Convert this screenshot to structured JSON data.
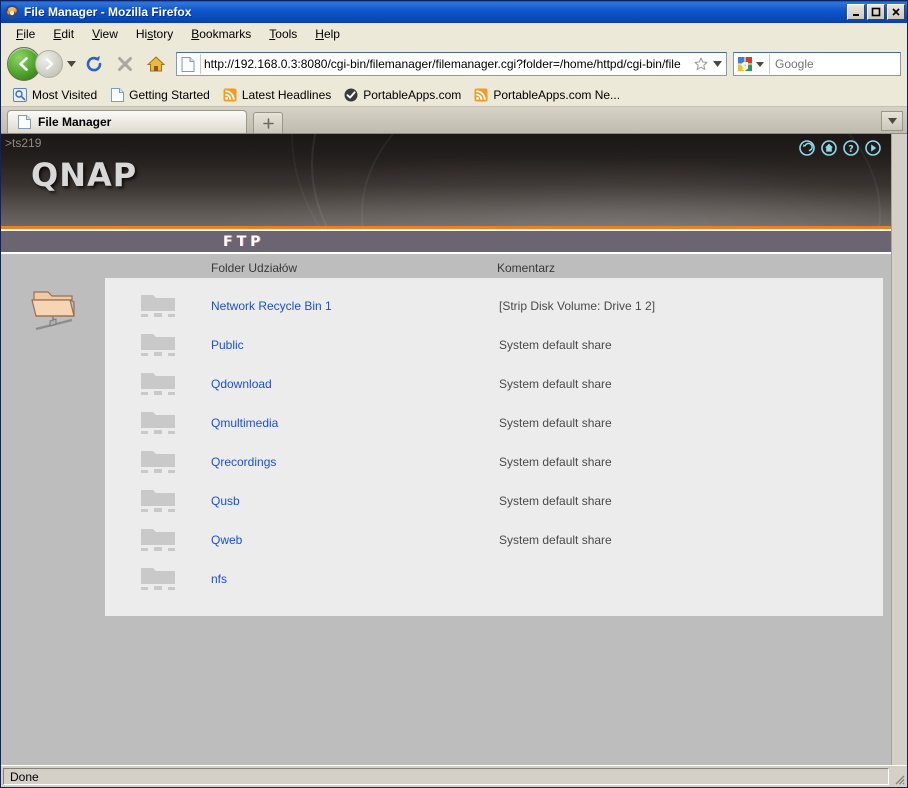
{
  "window": {
    "title": "File Manager - Mozilla Firefox",
    "minimize_label": "Minimize",
    "maximize_label": "Maximize",
    "close_label": "Close"
  },
  "menubar": {
    "items": [
      {
        "label": "File",
        "accel": "F"
      },
      {
        "label": "Edit",
        "accel": "E"
      },
      {
        "label": "View",
        "accel": "V"
      },
      {
        "label": "History",
        "accel": "s"
      },
      {
        "label": "Bookmarks",
        "accel": "B"
      },
      {
        "label": "Tools",
        "accel": "T"
      },
      {
        "label": "Help",
        "accel": "H"
      }
    ]
  },
  "toolbar": {
    "back_icon": "back-arrow-icon",
    "forward_icon": "forward-arrow-icon",
    "history_dropdown_icon": "chevron-down-icon",
    "reload_icon": "reload-icon",
    "stop_icon": "stop-icon",
    "home_icon": "home-icon",
    "url": "http://192.168.0.3:8080/cgi-bin/filemanager/filemanager.cgi?folder=/home/httpd/cgi-bin/file",
    "url_page_icon": "page-icon",
    "bookmark_star_icon": "star-icon",
    "url_dropdown_icon": "chevron-down-icon"
  },
  "search": {
    "engine": "Google",
    "engine_icon": "google-logo-icon",
    "engine_dropdown_icon": "chevron-down-icon",
    "placeholder": "Google",
    "go_icon": "magnifier-icon"
  },
  "bookmarks": {
    "items": [
      {
        "label": "Most Visited",
        "icon": "most-visited-icon"
      },
      {
        "label": "Getting Started",
        "icon": "page-icon"
      },
      {
        "label": "Latest Headlines",
        "icon": "rss-feed-icon"
      },
      {
        "label": "PortableApps.com",
        "icon": "portableapps-icon"
      },
      {
        "label": "PortableApps.com Ne...",
        "icon": "rss-feed-icon"
      }
    ]
  },
  "tabs": {
    "active": {
      "label": "File Manager",
      "icon": "page-icon"
    },
    "new_tab_label": "+",
    "tab_list_dropdown_icon": "chevron-down-icon"
  },
  "qnap": {
    "hostname": ">ts219",
    "logo": "QNAP",
    "banner_icons": [
      {
        "name": "back-circle-icon"
      },
      {
        "name": "home-circle-icon"
      },
      {
        "name": "help-circle-icon"
      },
      {
        "name": "forward-circle-icon"
      }
    ],
    "accent_orange": "#e8821e",
    "section_title": "FTP",
    "section_bar_color": "#6b6571"
  },
  "table": {
    "columns": [
      "Folder Udziałów",
      "Komentarz"
    ],
    "left_icon": "network-shared-folder-icon",
    "rows": [
      {
        "name": "Network Recycle Bin 1",
        "comment": "[Strip Disk Volume: Drive 1 2]",
        "icon": "folder-icon"
      },
      {
        "name": "Public",
        "comment": "System default share",
        "icon": "folder-icon"
      },
      {
        "name": "Qdownload",
        "comment": "System default share",
        "icon": "folder-icon"
      },
      {
        "name": "Qmultimedia",
        "comment": "System default share",
        "icon": "folder-icon"
      },
      {
        "name": "Qrecordings",
        "comment": "System default share",
        "icon": "folder-icon"
      },
      {
        "name": "Qusb",
        "comment": "System default share",
        "icon": "folder-icon"
      },
      {
        "name": "Qweb",
        "comment": "System default share",
        "icon": "folder-icon"
      },
      {
        "name": "nfs",
        "comment": "",
        "icon": "folder-icon"
      }
    ]
  },
  "statusbar": {
    "text": "Done"
  },
  "colors": {
    "page_background": "#bdbdbd",
    "panel_background": "#ececec",
    "link": "#1a4fdc",
    "chrome": "#ece9d8",
    "titlebar": "#0a50c8"
  }
}
